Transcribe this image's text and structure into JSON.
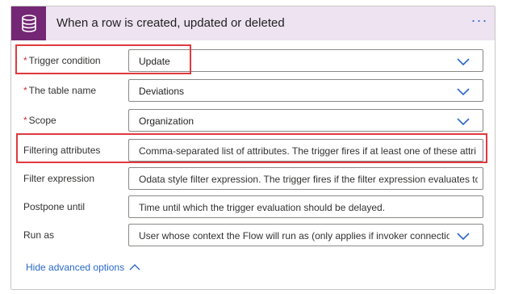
{
  "header": {
    "title": "When a row is created, updated or deleted",
    "icon": "database-icon",
    "menu_icon": "more-options-icon",
    "accent_color": "#742774",
    "header_bg": "#ede3f1"
  },
  "fields": [
    {
      "label": "Trigger condition",
      "required": "*",
      "value": "Update",
      "is_placeholder": false,
      "has_dropdown": true
    },
    {
      "label": "The table name",
      "required": "*",
      "value": "Deviations",
      "is_placeholder": false,
      "has_dropdown": true
    },
    {
      "label": "Scope",
      "required": "*",
      "value": "Organization",
      "is_placeholder": false,
      "has_dropdown": true
    },
    {
      "label": "Filtering attributes",
      "required": "",
      "value": "Comma-separated list of attributes. The trigger fires if at least one of these attri",
      "is_placeholder": true,
      "has_dropdown": false
    },
    {
      "label": "Filter expression",
      "required": "",
      "value": "Odata style filter expression. The trigger fires if the filter expression evaluates tc",
      "is_placeholder": true,
      "has_dropdown": false
    },
    {
      "label": "Postpone until",
      "required": "",
      "value": "Time until which the trigger evaluation should be delayed.",
      "is_placeholder": true,
      "has_dropdown": false
    },
    {
      "label": "Run as",
      "required": "",
      "value": "User whose context the Flow will run as (only applies if invoker connectio",
      "is_placeholder": true,
      "has_dropdown": true
    }
  ],
  "footer": {
    "hide_advanced_label": "Hide advanced options",
    "link_color": "#2a68c8"
  },
  "highlight_color": "#e0393e"
}
